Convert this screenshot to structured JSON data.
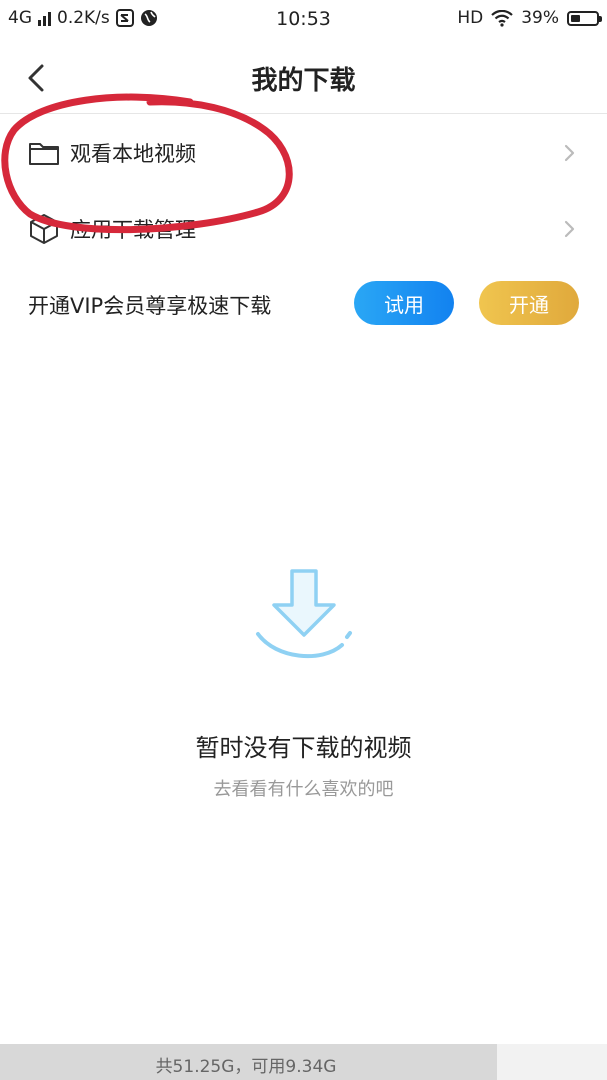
{
  "status_bar": {
    "network": "4G",
    "speed": "0.2K/s",
    "time": "10:53",
    "hd": "HD",
    "battery_text": "39%",
    "battery_level": 0.39
  },
  "nav": {
    "title": "我的下载"
  },
  "menu": {
    "local_videos": "观看本地视频",
    "app_downloads": "应用下载管理"
  },
  "vip": {
    "text": "开通VIP会员尊享极速下载",
    "trial_label": "试用",
    "open_label": "开通"
  },
  "empty_state": {
    "title": "暂时没有下载的视频",
    "subtitle": "去看看有什么喜欢的吧"
  },
  "storage": {
    "text": "共51.25G，可用9.34G",
    "used_fraction": 0.818
  },
  "colors": {
    "trial_button": "#1a92f2",
    "open_button": "#e8b746",
    "annotation": "#d6283a",
    "empty_icon": "#8fd1f3"
  }
}
